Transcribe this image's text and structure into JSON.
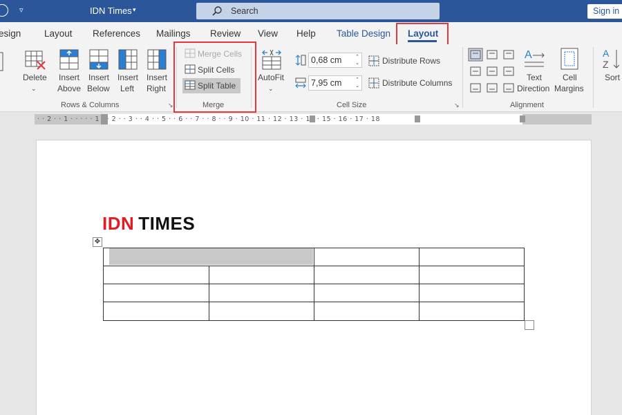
{
  "titlebar": {
    "qat_label": "▿",
    "doc_title": "IDN Times",
    "title_caret": "▾",
    "search_label": "Search",
    "signin_label": "Sign in"
  },
  "tabs": [
    {
      "label": "esign"
    },
    {
      "label": "Layout"
    },
    {
      "label": "References"
    },
    {
      "label": "Mailings"
    },
    {
      "label": "Review"
    },
    {
      "label": "View"
    },
    {
      "label": "Help"
    },
    {
      "label": "Table Design"
    },
    {
      "label": "Layout"
    }
  ],
  "ribbon": {
    "rows_columns": {
      "delete_label": "Delete",
      "insert_above_1": "Insert",
      "insert_above_2": "Above",
      "insert_below_1": "Insert",
      "insert_below_2": "Below",
      "insert_left_1": "Insert",
      "insert_left_2": "Left",
      "insert_right_1": "Insert",
      "insert_right_2": "Right",
      "group_label": "Rows & Columns"
    },
    "merge": {
      "merge_cells": "Merge Cells",
      "split_cells": "Split Cells",
      "split_table": "Split Table",
      "group_label": "Merge"
    },
    "cell_size": {
      "autofit_label": "AutoFit",
      "height_value": "0,68 cm",
      "width_value": "7,95 cm",
      "distribute_rows": "Distribute Rows",
      "distribute_columns": "Distribute Columns",
      "group_label": "Cell Size"
    },
    "alignment": {
      "text_direction_1": "Text",
      "text_direction_2": "Direction",
      "cell_margins_1": "Cell",
      "cell_margins_2": "Margins",
      "group_label": "Alignment"
    },
    "data": {
      "sort_label": "Sort"
    }
  },
  "ruler": {
    "text": "· · 2 · · 1 · · · · · 1 · · 2 · · 3 · · 4 · · 5 · · 6 · · 7 · · 8 · · 9 · 10 · 11 · 12 · 13 · 14 · 15 · 16 · 17 · 18"
  },
  "document": {
    "logo_idn": "IDN",
    "logo_times": "TIMES",
    "table": {
      "rows": 4,
      "columns": 4,
      "merged_first_row": true
    }
  },
  "colors": {
    "accent": "#2b579a",
    "highlight": "#e0383e",
    "logo_red": "#e51b23"
  }
}
